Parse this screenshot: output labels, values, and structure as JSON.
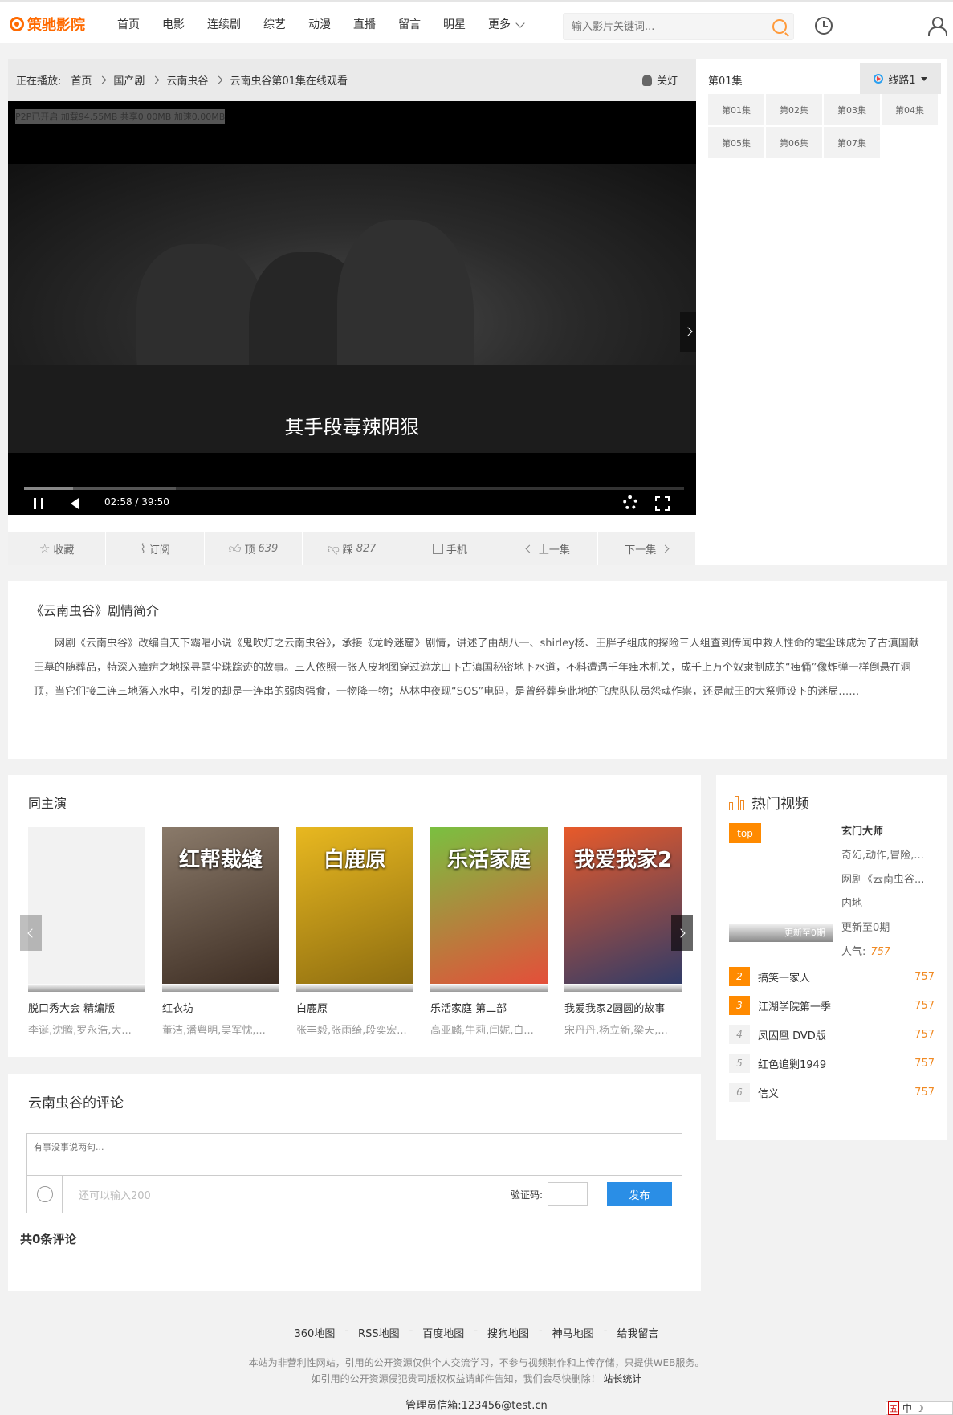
{
  "header": {
    "logo": "策驰影院",
    "nav": [
      "首页",
      "电影",
      "连续剧",
      "综艺",
      "动漫",
      "直播",
      "留言",
      "明星"
    ],
    "more": "更多",
    "search_placeholder": "输入影片关键词..."
  },
  "player": {
    "breadcrumb_prefix": "正在播放:",
    "breadcrumb": [
      "首页",
      "国产剧",
      "云南虫谷",
      "云南虫谷第01集在线观看"
    ],
    "lamp": "关灯",
    "p2p": "P2P已开启 加载94.55MB 共享0.00MB 加速0.00MB",
    "subtitle": "其手段毒辣阴狠",
    "time": "02:58 / 39:50",
    "progress": 0.074,
    "actions": {
      "favorite": "收藏",
      "subscribe": "订阅",
      "up_label": "顶",
      "up_count": "639",
      "down_label": "踩",
      "down_count": "827",
      "mobile": "手机",
      "prev": "上一集",
      "next": "下一集"
    }
  },
  "episodes": {
    "current": "第01集",
    "route": "线路1",
    "list": [
      "第01集",
      "第02集",
      "第03集",
      "第04集",
      "第05集",
      "第06集",
      "第07集"
    ]
  },
  "intro": {
    "title": "《云南虫谷》剧情简介",
    "text": "网剧《云南虫谷》改编自天下霸唱小说《鬼吹灯之云南虫谷》，承接《龙岭迷窟》剧情，讲述了由胡八一、shirley杨、王胖子组成的探险三人组查到传闻中救人性命的雮尘珠成为了古滇国献王墓的随葬品，特深入瘴疠之地探寻雮尘珠踪迹的故事。三人依照一张人皮地图穿过遮龙山下古滇国秘密地下水道，不料遭遇千年痋术机关，成千上万个奴隶制成的“痋俑”像炸弹一样倒悬在洞顶，当它们接二连三地落入水中，引发的却是一连串的弱肉强食，一物降一物；丛林中夜现“SOS”电码，是曾经葬身此地的飞虎队队员怨魂作祟，还是献王的大祭师设下的迷局……"
  },
  "cast": {
    "title": "同主演",
    "items": [
      {
        "title": "脱口秀大会 精编版",
        "actors": "李诞,沈腾,罗永浩,大..."
      },
      {
        "title": "红衣坊",
        "actors": "董洁,潘粤明,吴军忱,..."
      },
      {
        "title": "白鹿原",
        "actors": "张丰毅,张雨绮,段奕宏..."
      },
      {
        "title": "乐活家庭 第二部",
        "actors": "高亚麟,牛莉,闫妮,白..."
      },
      {
        "title": "我爱我家2圆圆的故事",
        "actors": "宋丹丹,杨立新,梁天,..."
      }
    ],
    "posters": [
      {
        "text": "",
        "colors": [
          "#f2f2f2",
          "#f2f2f2"
        ]
      },
      {
        "text": "红帮裁缝",
        "colors": [
          "#8a7a6a",
          "#3a2a20"
        ]
      },
      {
        "text": "白鹿原",
        "colors": [
          "#e8b820",
          "#8a6a10"
        ]
      },
      {
        "text": "乐活家庭",
        "colors": [
          "#7ac040",
          "#e84a3a"
        ]
      },
      {
        "text": "我爱我家2",
        "colors": [
          "#e85a2a",
          "#2a3a6a"
        ]
      }
    ]
  },
  "hot": {
    "title": "热门视频",
    "top": {
      "badge": "top",
      "name": "玄门大师",
      "genre": "奇幻,动作,冒险,...",
      "desc": "网剧《云南虫谷...",
      "region": "内地",
      "status": "更新至0期",
      "pop_label": "人气:",
      "pop": "757",
      "bar": "更新至0期"
    },
    "list": [
      {
        "rank": "2",
        "name": "搞笑一家人",
        "value": "757"
      },
      {
        "rank": "3",
        "name": "江湖学院第一季",
        "value": "757"
      },
      {
        "rank": "4",
        "name": "凤囚凰 DVD版",
        "value": "757"
      },
      {
        "rank": "5",
        "name": "红色追剿1949",
        "value": "757"
      },
      {
        "rank": "6",
        "name": "信义",
        "value": "757"
      }
    ]
  },
  "comments": {
    "title": "云南虫谷的评论",
    "placeholder": "有事没事说两句...",
    "remain": "还可以输入200",
    "captcha_label": "验证码:",
    "submit": "发布",
    "count_text": "共0条评论"
  },
  "footer": {
    "links": [
      "360地图",
      "RSS地图",
      "百度地图",
      "搜狗地图",
      "神马地图",
      "给我留言"
    ],
    "note1": "本站为非营利性网站，引用的公开资源仅供个人交流学习，不参与视频制作和上传存储，只提供WEB服务。",
    "note2": "如引用的公开资源侵犯贵司版权权益请邮件告知，我们会尽快删除！",
    "stat": "站长统计",
    "email": "管理员信箱:123456@test.cn"
  },
  "ime": {
    "badge": "五",
    "lang": "中"
  }
}
